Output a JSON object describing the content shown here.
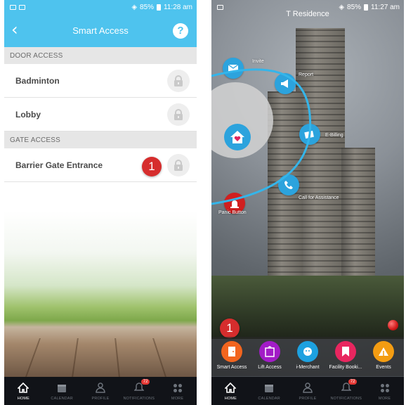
{
  "left": {
    "status": {
      "battery": "85%",
      "time": "11:28 am"
    },
    "appbar": {
      "title": "Smart Access",
      "help": "?",
      "back": "‹"
    },
    "door_section": "DOOR ACCESS",
    "doors": [
      {
        "name": "Badminton"
      },
      {
        "name": "Lobby"
      }
    ],
    "gate_section": "GATE ACCESS",
    "gates": [
      {
        "name": "Barrier Gate Entrance"
      }
    ],
    "badge": "1"
  },
  "right": {
    "status": {
      "battery": "85%",
      "time": "11:27 am"
    },
    "title": "T Residence",
    "menu": {
      "invite": "Invite",
      "report": "Report",
      "ebilling": "E-Billing",
      "call": "Call for Assistance",
      "panic": "Panic Button"
    },
    "badge": "1",
    "shortcuts": [
      {
        "label": "Smart Access",
        "color": "#f2651f",
        "icon": "door-icon"
      },
      {
        "label": "Lift Access",
        "color": "#a21cc7",
        "icon": "lift-icon"
      },
      {
        "label": "i-Merchant",
        "color": "#1da1e0",
        "icon": "merchant-icon"
      },
      {
        "label": "Facility Booki...",
        "color": "#e8265f",
        "icon": "bookmark-icon"
      },
      {
        "label": "Events",
        "color": "#f39c12",
        "icon": "tent-icon"
      }
    ]
  },
  "nav": {
    "home": "HOME",
    "calendar": "CALENDAR",
    "profile": "PROFILE",
    "notifications": "NOTIFICATIONS",
    "notif_count": "72",
    "more": "MORE"
  },
  "colors": {
    "accent": "#4ec3ee",
    "badge": "#d62d2d"
  }
}
